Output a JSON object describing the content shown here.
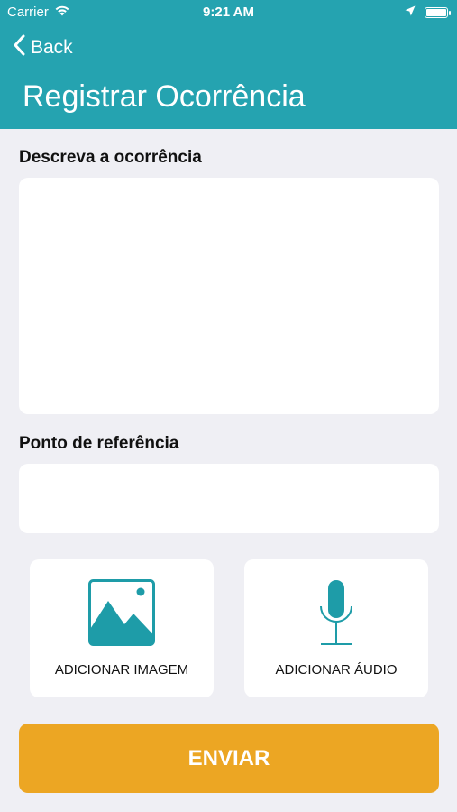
{
  "status_bar": {
    "carrier": "Carrier",
    "time": "9:21 AM",
    "icons": [
      "wifi-icon",
      "location-arrow-icon",
      "battery-icon"
    ]
  },
  "nav": {
    "back_label": "Back",
    "title": "Registrar Ocorrência"
  },
  "form": {
    "description_label": "Descreva a ocorrência",
    "description_value": "",
    "reference_label": "Ponto de referência",
    "reference_value": ""
  },
  "media": {
    "add_image_label": "ADICIONAR IMAGEM",
    "add_audio_label": "ADICIONAR ÁUDIO"
  },
  "submit_label": "ENVIAR",
  "colors": {
    "header": "#25a3b0",
    "accent": "#1e9ca8",
    "submit": "#eca623",
    "background": "#efeff4"
  }
}
